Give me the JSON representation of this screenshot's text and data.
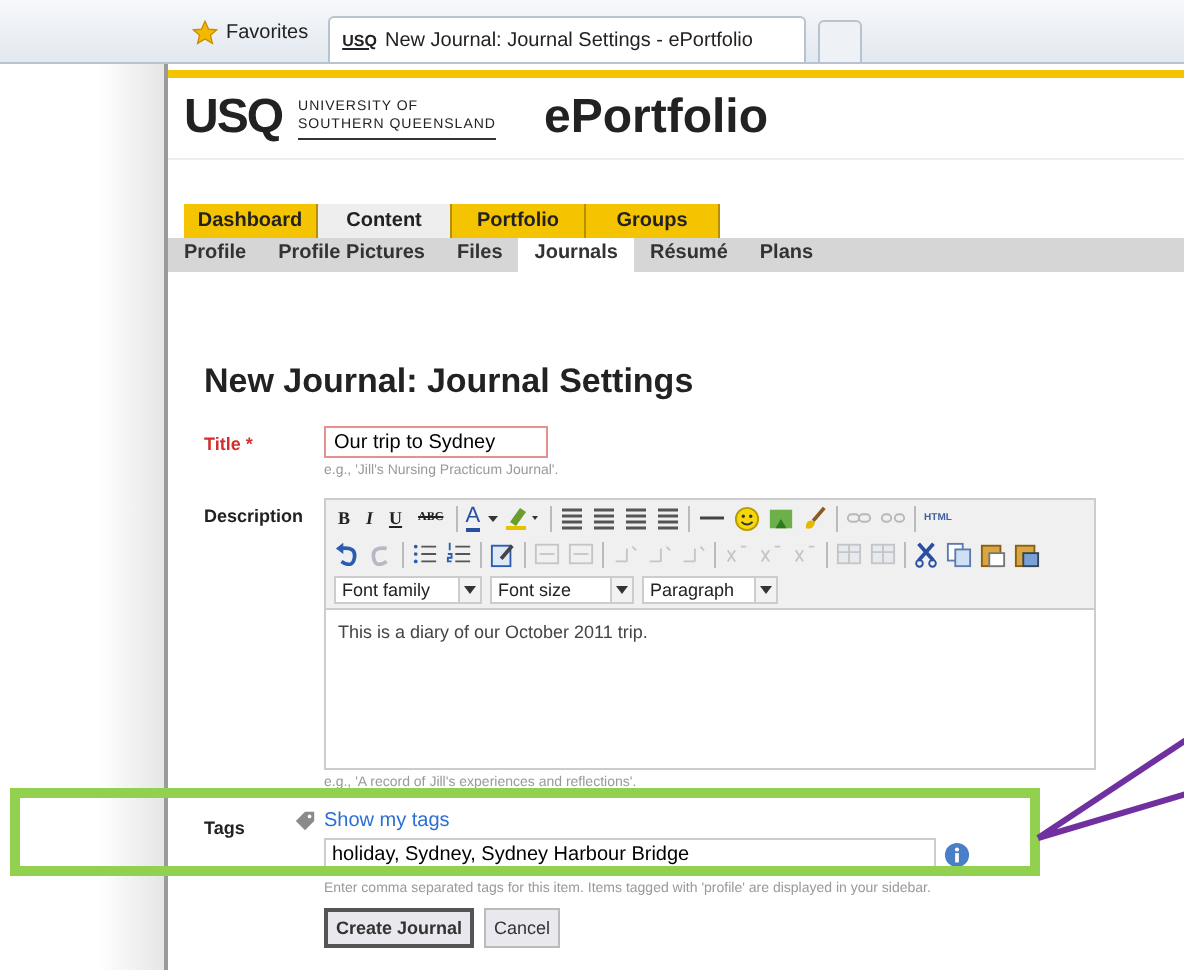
{
  "browser": {
    "favorites": "Favorites",
    "tab_favicon": "USQ",
    "tab_title": "New Journal: Journal Settings - ePortfolio"
  },
  "header": {
    "logo": "USQ",
    "university": [
      "UNIVERSITY OF",
      "SOUTHERN QUEENSLAND"
    ],
    "app_name": "ePortfolio"
  },
  "main_tabs": [
    {
      "label": "Dashboard",
      "selected": false
    },
    {
      "label": "Content",
      "selected": true
    },
    {
      "label": "Portfolio",
      "selected": false
    },
    {
      "label": "Groups",
      "selected": false
    }
  ],
  "sub_tabs": [
    {
      "label": "Profile",
      "selected": false
    },
    {
      "label": "Profile Pictures",
      "selected": false
    },
    {
      "label": "Files",
      "selected": false
    },
    {
      "label": "Journals",
      "selected": true
    },
    {
      "label": "Résumé",
      "selected": false
    },
    {
      "label": "Plans",
      "selected": false
    }
  ],
  "form": {
    "heading": "New Journal: Journal Settings",
    "title": {
      "label": "Title",
      "required_mark": "*",
      "value": "Our trip to Sydney",
      "hint": "e.g., 'Jill's Nursing Practicum Journal'."
    },
    "description": {
      "label": "Description",
      "text_buttons": [
        "B",
        "I",
        "U",
        "ABC"
      ],
      "text_color_button": "A",
      "html_button": "HTML",
      "font_family": "Font family",
      "font_size": "Font size",
      "format": "Paragraph",
      "value": "This is a diary of our October 2011 trip.",
      "hint": "e.g., 'A record of Jill's experiences and reflections'."
    },
    "tags": {
      "label": "Tags",
      "link": "Show my tags",
      "value": "holiday, Sydney, Sydney Harbour Bridge",
      "hint": "Enter comma separated tags for this item. Items tagged with 'profile' are displayed in your sidebar."
    },
    "buttons": [
      {
        "label": "Create Journal",
        "kind": "primary"
      },
      {
        "label": "Cancel",
        "kind": "secondary"
      }
    ]
  }
}
